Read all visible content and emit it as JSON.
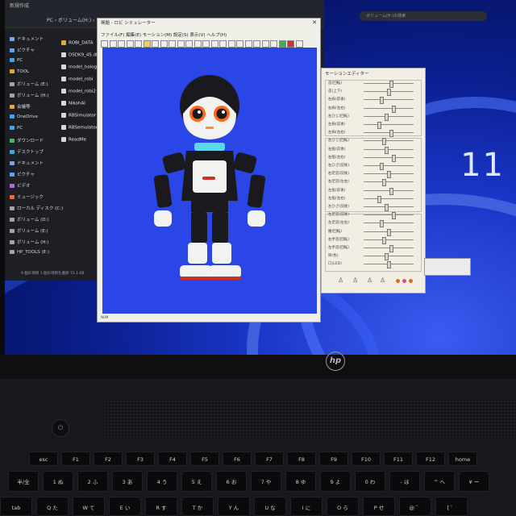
{
  "photo": {
    "subject": "laptop",
    "laptop_brand": "hp",
    "os_badge": "11"
  },
  "explorer": {
    "window_title": "新規作成",
    "path": "PC › ボリューム(H:) › ...",
    "search_placeholder": "ボリューム(H:)の検索",
    "nav_items": [
      {
        "label": "ドキュメント",
        "color": "#7ea6e0"
      },
      {
        "label": "ピクチャ",
        "color": "#5fa0f0"
      },
      {
        "label": "PC",
        "color": "#4aa3e8"
      },
      {
        "label": "TOOL",
        "color": "#e0a93a"
      },
      {
        "label": "ボリューム (E:)",
        "color": "#a0a4ab"
      },
      {
        "label": "ボリューム (H:)",
        "color": "#a0a4ab"
      },
      {
        "label": "会議等",
        "color": "#e0a93a"
      },
      {
        "label": "OneDrive",
        "color": "#4aa3e8"
      },
      {
        "label": "PC",
        "color": "#4aa3e8"
      },
      {
        "label": "ダウンロード",
        "color": "#49b870"
      },
      {
        "label": "デスクトップ",
        "color": "#4aa3e8"
      },
      {
        "label": "ドキュメント",
        "color": "#7ea6e0"
      },
      {
        "label": "ピクチャ",
        "color": "#5fa0f0"
      },
      {
        "label": "ビデオ",
        "color": "#a86ee0"
      },
      {
        "label": "ミュージック",
        "color": "#e07040"
      },
      {
        "label": "ローカル ディスク (C:)",
        "color": "#a0a4ab"
      },
      {
        "label": "ボリューム (D:)",
        "color": "#a0a4ab"
      },
      {
        "label": "ボリューム (E:)",
        "color": "#a0a4ab"
      },
      {
        "label": "ボリューム (H:)",
        "color": "#a0a4ab"
      },
      {
        "label": "HP_TOOLS (E:)",
        "color": "#a0a4ab"
      }
    ],
    "files": [
      "ROBI_DATA",
      "DSDK9_45.dll",
      "model_hologram",
      "model_robi",
      "model_robi2",
      "NikohAI",
      "RBSimulator",
      "RBSemulator",
      "ReadMe"
    ],
    "status": "9 個の項目  1 個の項目を選択 73.1 KB"
  },
  "simulator": {
    "title": "無題 - ロビ シミュレーター",
    "menu": "ファイル(F)  編集(E)  モーション(M)  設定(S)  表示(V)  ヘルプ(H)",
    "status": "NUM"
  },
  "motion_panel": {
    "title": "モーションエディター",
    "slider_labels": [
      "首(回転)",
      "首(上下)",
      "右肩(前後)",
      "右肩(左右)",
      "右ひじ(回転)",
      "左肩(前後)",
      "左肩(左右)",
      "左ひじ(回転)",
      "右股(前後)",
      "右股(左右)",
      "右ひざ(前後)",
      "右足首(前後)",
      "右足首(左右)",
      "左股(前後)",
      "左股(左右)",
      "左ひざ(前後)",
      "左足首(前後)",
      "左足首(左右)",
      "腰(回転)",
      "右手首(回転)",
      "左手首(回転)",
      "目(色)",
      "口(LED)"
    ],
    "slider_values": [
      0.55,
      0.5,
      0.35,
      0.6,
      0.45,
      0.3,
      0.55,
      0.4,
      0.45,
      0.6,
      0.35,
      0.5,
      0.4,
      0.55,
      0.3,
      0.45,
      0.6,
      0.35,
      0.5,
      0.4,
      0.55,
      0.45,
      0.5
    ]
  },
  "keyboard": {
    "row1": [
      "esc",
      "F1",
      "F2",
      "F3",
      "F4",
      "F5",
      "F6",
      "F7",
      "F8",
      "F9",
      "F10",
      "F11",
      "F12",
      "home"
    ],
    "row2": [
      "半/全",
      "1 ぬ",
      "2 ふ",
      "3 あ",
      "4 う",
      "5 え",
      "6 お",
      "7 や",
      "8 ゆ",
      "9 よ",
      "0 わ",
      "- ほ",
      "^ へ",
      "¥ ー"
    ],
    "row3": [
      "tab",
      "Q た",
      "W て",
      "E い",
      "R す",
      "T か",
      "Y ん",
      "U な",
      "I に",
      "O ら",
      "P せ",
      "@ ゛",
      "[ ゜"
    ]
  },
  "colors": {
    "wallpaper_blue": "#1a36c8",
    "viewport_blue": "#2a46e6",
    "robot_black": "#1a1a1e",
    "robot_white": "#f2f2f0",
    "robot_eye_orange": "#ff6a1a",
    "robot_collar_cyan": "#5ed6ea",
    "robot_logo_red": "#c8302a"
  }
}
